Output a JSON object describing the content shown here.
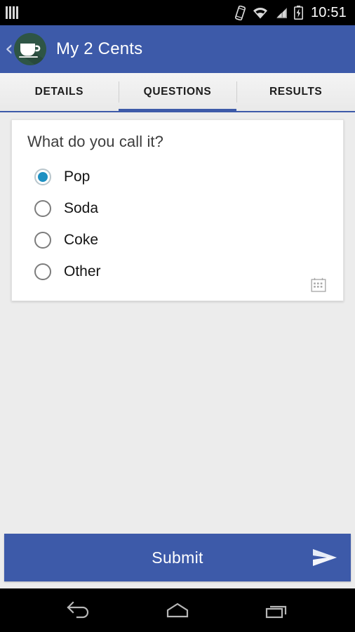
{
  "status_bar": {
    "time": "10:51",
    "icons": [
      {
        "name": "sim-bars-icon"
      },
      {
        "name": "vibrate-icon"
      },
      {
        "name": "wifi-icon"
      },
      {
        "name": "cellular-signal-icon"
      },
      {
        "name": "battery-charging-icon"
      }
    ]
  },
  "app_bar": {
    "back_label": "‹",
    "logo_icon": "coffee-cup-icon",
    "title": "My 2 Cents",
    "background_color": "#3d5aa9"
  },
  "tabs": [
    {
      "label": "DETAILS",
      "active": false
    },
    {
      "label": "QUESTIONS",
      "active": true
    },
    {
      "label": "RESULTS",
      "active": false
    }
  ],
  "question_card": {
    "title": "What do you call it?",
    "options": [
      {
        "label": "Pop",
        "selected": true
      },
      {
        "label": "Soda",
        "selected": false
      },
      {
        "label": "Coke",
        "selected": false
      },
      {
        "label": "Other",
        "selected": false
      }
    ],
    "footer_icon": "calendar-icon",
    "selected_color": "#1e90c2"
  },
  "submit": {
    "label": "Submit",
    "icon": "send-icon",
    "background_color": "#3d5aa9"
  },
  "nav_bar": {
    "buttons": [
      {
        "name": "back-nav-icon"
      },
      {
        "name": "home-nav-icon"
      },
      {
        "name": "recents-nav-icon"
      }
    ]
  }
}
